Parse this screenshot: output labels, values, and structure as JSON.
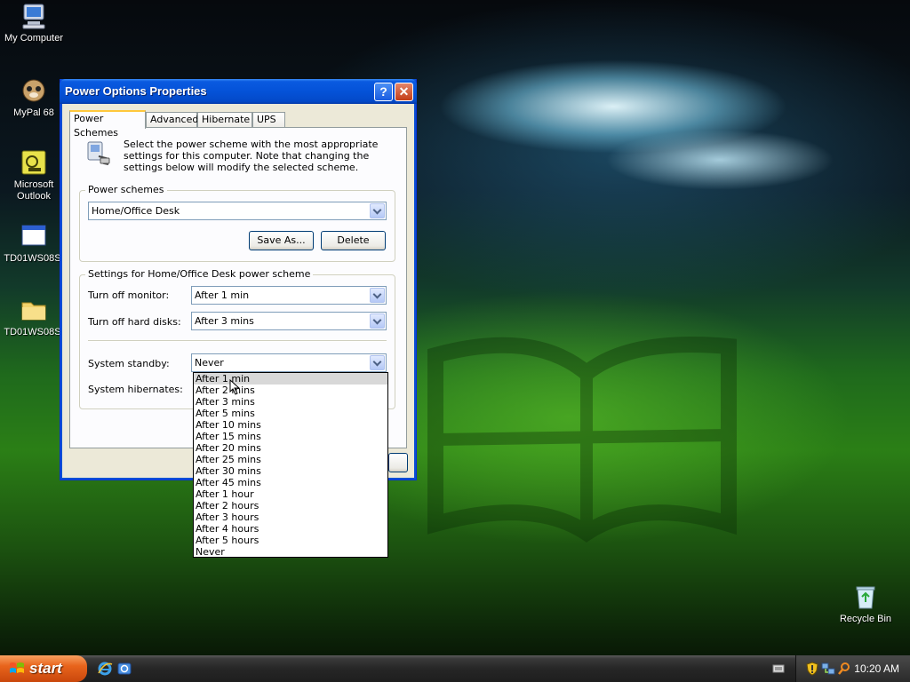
{
  "desktop": {
    "icons": [
      {
        "label": "My Computer"
      },
      {
        "label": "MyPal 68"
      },
      {
        "label": "Microsoft Outlook"
      },
      {
        "label": "TD01WS08S."
      },
      {
        "label": "TD01WS08S."
      },
      {
        "label": "Recycle Bin"
      }
    ]
  },
  "window": {
    "title": "Power Options Properties",
    "help_glyph": "?",
    "close_glyph": "✕",
    "tabs": [
      {
        "label": "Power Schemes",
        "active": true
      },
      {
        "label": "Advanced",
        "active": false
      },
      {
        "label": "Hibernate",
        "active": false
      },
      {
        "label": "UPS",
        "active": false
      }
    ],
    "intro_text": "Select the power scheme with the most appropriate settings for this computer. Note that changing the settings below will modify the selected scheme.",
    "power_schemes": {
      "group_title": "Power schemes",
      "selected": "Home/Office Desk",
      "save_as_label": "Save As...",
      "delete_label": "Delete"
    },
    "settings": {
      "group_title": "Settings for Home/Office Desk power scheme",
      "turn_off_monitor_label": "Turn off monitor:",
      "turn_off_monitor_value": "After 1 min",
      "turn_off_hard_disks_label": "Turn off hard disks:",
      "turn_off_hard_disks_value": "After 3 mins",
      "system_standby_label": "System standby:",
      "system_standby_value": "Never",
      "system_hibernates_label": "System hibernates:"
    },
    "standby_options": [
      "After 1 min",
      "After 2 mins",
      "After 3 mins",
      "After 5 mins",
      "After 10 mins",
      "After 15 mins",
      "After 20 mins",
      "After 25 mins",
      "After 30 mins",
      "After 45 mins",
      "After 1 hour",
      "After 2 hours",
      "After 3 hours",
      "After 4 hours",
      "After 5 hours",
      "Never"
    ],
    "highlighted_option": "After 1 min"
  },
  "taskbar": {
    "start_label": "start",
    "clock": "10:20 AM"
  },
  "colors": {
    "title_blue": "#0452d8",
    "dialog_bg": "#ece9d8",
    "start_orange": "#e8641c"
  }
}
